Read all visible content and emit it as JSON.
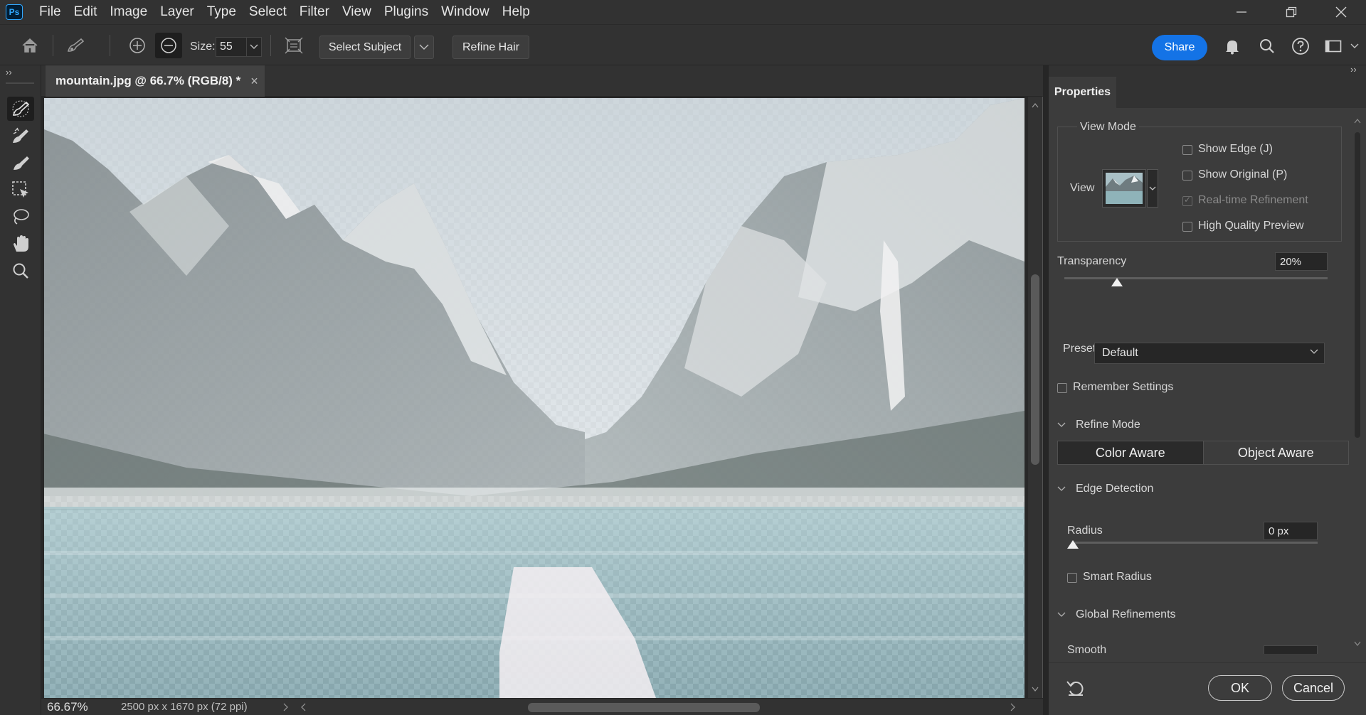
{
  "app": {
    "logo_text": "Ps",
    "accent": "#31a8ff"
  },
  "menu": [
    "File",
    "Edit",
    "Image",
    "Layer",
    "Type",
    "Select",
    "Filter",
    "View",
    "Plugins",
    "Window",
    "Help"
  ],
  "options_bar": {
    "size_label": "Size:",
    "size_value": "55",
    "select_subject_label": "Select Subject",
    "refine_hair_label": "Refine Hair",
    "share_label": "Share",
    "share_color": "#1473e6"
  },
  "document": {
    "tab_title": "mountain.jpg @ 66.7% (RGB/8) *",
    "close_glyph": "×",
    "zoom": "66.67%",
    "info": "2500 px x 1670 px (72 ppi)"
  },
  "properties": {
    "tab_label": "Properties",
    "view_mode_label": "View Mode",
    "view_label": "View",
    "show_edge": "Show Edge (J)",
    "show_original": "Show Original (P)",
    "realtime_refinement": "Real-time Refinement",
    "high_quality_preview": "High Quality Preview",
    "transparency_label": "Transparency",
    "transparency_value": "20%",
    "transparency_level": 0.2,
    "preset_label": "Preset",
    "preset_value": "Default",
    "remember_settings": "Remember Settings",
    "refine_mode_label": "Refine Mode",
    "color_aware": "Color Aware",
    "object_aware": "Object Aware",
    "edge_detection_label": "Edge Detection",
    "radius_label": "Radius",
    "radius_value": "0 px",
    "radius_level": 0,
    "smart_radius": "Smart Radius",
    "global_refinements_label": "Global Refinements",
    "smooth_label": "Smooth",
    "ok_label": "OK",
    "cancel_label": "Cancel"
  },
  "tools": [
    "quick-selection-brush-icon",
    "refine-edge-brush-icon",
    "brush-icon",
    "object-selection-icon",
    "lasso-icon",
    "hand-icon",
    "zoom-icon"
  ]
}
